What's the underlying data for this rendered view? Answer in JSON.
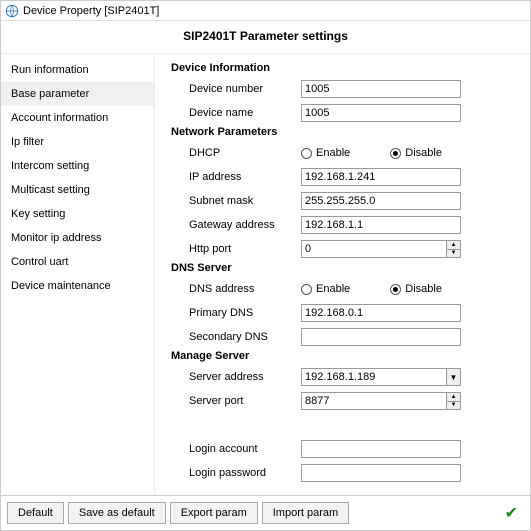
{
  "window": {
    "title": "Device Property [SIP2401T]",
    "icon": "globe-icon"
  },
  "header": {
    "title": "SIP2401T Parameter settings"
  },
  "sidebar": {
    "items": [
      {
        "label": "Run information"
      },
      {
        "label": "Base parameter"
      },
      {
        "label": "Account information"
      },
      {
        "label": "Ip filter"
      },
      {
        "label": "Intercom setting"
      },
      {
        "label": "Multicast setting"
      },
      {
        "label": "Key setting"
      },
      {
        "label": "Monitor ip address"
      },
      {
        "label": "Control uart"
      },
      {
        "label": "Device maintenance"
      }
    ],
    "active_index": 1
  },
  "sections": {
    "device_info": {
      "title": "Device Information",
      "device_number_label": "Device number",
      "device_number": "1005",
      "device_name_label": "Device name",
      "device_name": "1005"
    },
    "network": {
      "title": "Network Parameters",
      "dhcp_label": "DHCP",
      "dhcp_enable_label": "Enable",
      "dhcp_disable_label": "Disable",
      "dhcp_value": "Disable",
      "ip_label": "IP address",
      "ip": "192.168.1.241",
      "subnet_label": "Subnet mask",
      "subnet": "255.255.255.0",
      "gateway_label": "Gateway address",
      "gateway": "192.168.1.1",
      "http_port_label": "Http port",
      "http_port": "0"
    },
    "dns": {
      "title": "DNS Server",
      "dns_addr_label": "DNS address",
      "dns_enable_label": "Enable",
      "dns_disable_label": "Disable",
      "dns_value": "Disable",
      "primary_label": "Primary DNS",
      "primary": "192.168.0.1",
      "secondary_label": "Secondary DNS",
      "secondary": ""
    },
    "manage": {
      "title": "Manage Server",
      "server_addr_label": "Server address",
      "server_addr": "192.168.1.189",
      "server_port_label": "Server port",
      "server_port": "8877",
      "login_account_label": "Login account",
      "login_account": "",
      "login_password_label": "Login password",
      "login_password": ""
    }
  },
  "footer": {
    "default_btn": "Default",
    "save_default_btn": "Save as default",
    "export_btn": "Export param",
    "import_btn": "Import param"
  }
}
